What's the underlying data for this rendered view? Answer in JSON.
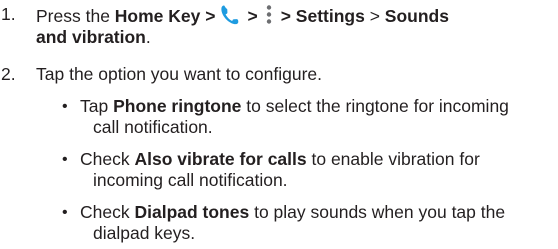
{
  "steps": [
    {
      "number": "1.",
      "prefix": "Press the ",
      "home_key": "Home Key >",
      "sep1": ">",
      "sep2": "> Settings",
      "sep3": " > ",
      "target_a": "Sounds",
      "target_b": "and vibration",
      "period": "."
    },
    {
      "number": "2.",
      "text": "Tap the option you want to configure."
    }
  ],
  "bullets": [
    {
      "verb": "Tap ",
      "bold": "Phone ringtone",
      "rest": " to select the ringtone for incoming",
      "cont": "call notification."
    },
    {
      "verb": "Check ",
      "bold": "Also vibrate for calls",
      "rest": " to enable vibration for",
      "cont": "incoming call notification."
    },
    {
      "verb": "Check ",
      "bold": "Dialpad tones",
      "rest": " to play sounds when you tap the",
      "cont": "dialpad keys."
    }
  ],
  "bullet_glyph": "•",
  "icons": {
    "phone": "phone-icon",
    "menu": "vertical-dots-menu-icon"
  },
  "colors": {
    "text": "#231f20",
    "phone_icon": "#1e9be0",
    "menu_icon": "#6d6e71"
  }
}
